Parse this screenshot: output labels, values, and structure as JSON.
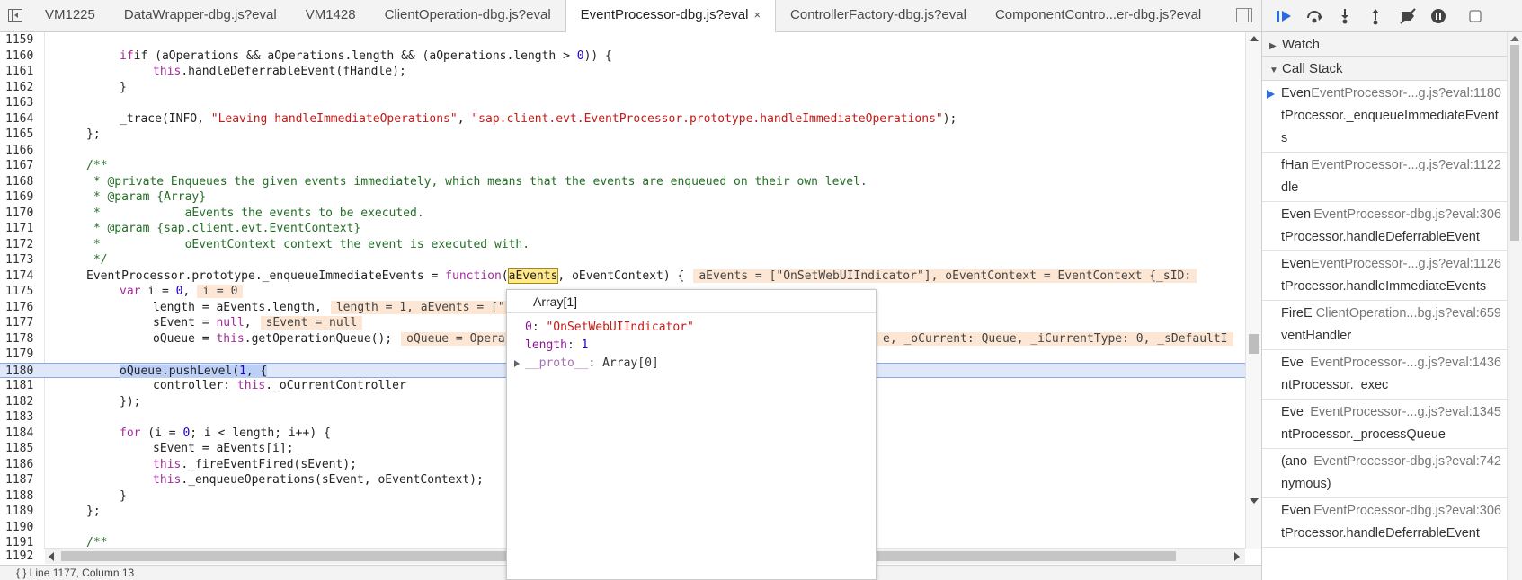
{
  "tabs": [
    {
      "label": "VM1225"
    },
    {
      "label": "DataWrapper-dbg.js?eval"
    },
    {
      "label": "VM1428"
    },
    {
      "label": "ClientOperation-dbg.js?eval"
    },
    {
      "label": "EventProcessor-dbg.js?eval",
      "active": true
    },
    {
      "label": "ControllerFactory-dbg.js?eval"
    },
    {
      "label": "ComponentContro...er-dbg.js?eval"
    }
  ],
  "close_glyph": "×",
  "lines": [
    {
      "n": "1159"
    },
    {
      "n": "1160"
    },
    {
      "n": "1161"
    },
    {
      "n": "1162"
    },
    {
      "n": "1163"
    },
    {
      "n": "1164"
    },
    {
      "n": "1165"
    },
    {
      "n": "1166"
    },
    {
      "n": "1167"
    },
    {
      "n": "1168"
    },
    {
      "n": "1169"
    },
    {
      "n": "1170"
    },
    {
      "n": "1171"
    },
    {
      "n": "1172"
    },
    {
      "n": "1173"
    },
    {
      "n": "1174"
    },
    {
      "n": "1175"
    },
    {
      "n": "1176"
    },
    {
      "n": "1177"
    },
    {
      "n": "1178"
    },
    {
      "n": "1179"
    },
    {
      "n": "1180"
    },
    {
      "n": "1181"
    },
    {
      "n": "1182"
    },
    {
      "n": "1183"
    },
    {
      "n": "1184"
    },
    {
      "n": "1185"
    },
    {
      "n": "1186"
    },
    {
      "n": "1187"
    },
    {
      "n": "1188"
    },
    {
      "n": "1189"
    },
    {
      "n": "1190"
    },
    {
      "n": "1191"
    },
    {
      "n": "1192"
    }
  ],
  "code": {
    "l1160a": "if (aOperations && aOperations.length && (aOperations.length > ",
    "l1160n": "0",
    "l1160b": ")) {",
    "l1161kw": "this",
    "l1161": ".handleDeferrableEvent(fHandle);",
    "l1162": "}",
    "l1164a": "_trace(INFO, ",
    "l1164s1": "\"Leaving handleImmediateOperations\"",
    "l1164b": ", ",
    "l1164s2": "\"sap.client.evt.EventProcessor.prototype.handleImmediateOperations\"",
    "l1164c": ");",
    "l1165": "};",
    "l1167": "/**",
    "l1168": " * @private Enqueues the given events immediately, which means that the events are enqueued on their own level.",
    "l1169": " * @param {Array}",
    "l1170": " *            aEvents the events to be executed.",
    "l1171": " * @param {sap.client.evt.EventContext}",
    "l1172": " *            oEventContext context the event is executed with.",
    "l1173": " */",
    "l1174a": "EventProcessor.prototype._enqueueImmediateEvents = ",
    "l1174kw": "function",
    "l1174b": "(",
    "l1174hl": "aEvents",
    "l1174c": ", oEventContext) {",
    "l1174val": "aEvents = [\"OnSetWebUIIndicator\"], oEventContext = EventContext {_sID:",
    "l1175kw": "var",
    "l1175a": " i = ",
    "l1175n": "0",
    "l1175b": ",",
    "l1175val": "i = 0",
    "l1176": "length = aEvents.length,",
    "l1176val": "length = 1, aEvents = [\"",
    "l1177a": "sEvent = ",
    "l1177kw": "null",
    "l1177b": ",",
    "l1177val": "sEvent = null",
    "l1178a": "oQueue = ",
    "l1178kw": "this",
    "l1178b": ".getOperationQueue();",
    "l1178val": "oQueue = Opera",
    "l1178val2": "e, _oCurrent: Queue, _iCurrentType: 0, _sDefaultI",
    "l1180a": "oQueue.pushLevel(",
    "l1180n": "1",
    "l1180b": ", {",
    "l1181a": "controller: ",
    "l1181kw": "this",
    "l1181b": "._oCurrentController",
    "l1182": "});",
    "l1184kw": "for",
    "l1184a": " (i = ",
    "l1184n": "0",
    "l1184b": "; i < length; i++) {",
    "l1185": "sEvent = aEvents[i];",
    "l1186kw": "this",
    "l1186": "._fireEventFired(sEvent);",
    "l1187kw": "this",
    "l1187": "._enqueueOperations(sEvent, oEventContext);",
    "l1188": "}",
    "l1189": "};",
    "l1191": "/**"
  },
  "popover": {
    "title": "Array[1]",
    "rows": [
      {
        "key": "0",
        "value": "\"OnSetWebUIIndicator\""
      },
      {
        "key": "length",
        "value": "1"
      },
      {
        "key": "__proto__",
        "value": "Array[0]"
      }
    ]
  },
  "status": "{ }   Line 1177, Column 13",
  "debugger": {
    "watch_label": "Watch",
    "callstack_label": "Call Stack",
    "frames": [
      {
        "name": "EventProcessor._enqueueImmediateEvents",
        "loc": "EventProcessor-...g.js?eval:1180",
        "current": true
      },
      {
        "name": "fHandle",
        "loc": "EventProcessor-...g.js?eval:1122"
      },
      {
        "name": "EventProcessor.handleDeferrableEvent",
        "loc": "EventProcessor-dbg.js?eval:306"
      },
      {
        "name": "EventProcessor.handleImmediateEvents",
        "loc": "EventProcessor-...g.js?eval:1126"
      },
      {
        "name": "FireEventHandler",
        "loc": "ClientOperation...bg.js?eval:659"
      },
      {
        "name": "EventProcessor._exec",
        "loc": "EventProcessor-...g.js?eval:1436"
      },
      {
        "name": "EventProcessor._processQueue",
        "loc": "EventProcessor-...g.js?eval:1345"
      },
      {
        "name": "(anonymous)",
        "loc": "EventProcessor-dbg.js?eval:742"
      },
      {
        "name": "EventProcessor.handleDeferrableEvent",
        "loc": "EventProcessor-dbg.js?eval:306"
      }
    ]
  },
  "colors": {
    "keyword": "#a42c9c",
    "string": "#c41a16",
    "number": "#1c00cf",
    "comment": "#236e25",
    "exec_line": "#dfe7fb",
    "inline_value_bg": "#fde7d4",
    "current_frame_arrow": "#2d6de0"
  }
}
